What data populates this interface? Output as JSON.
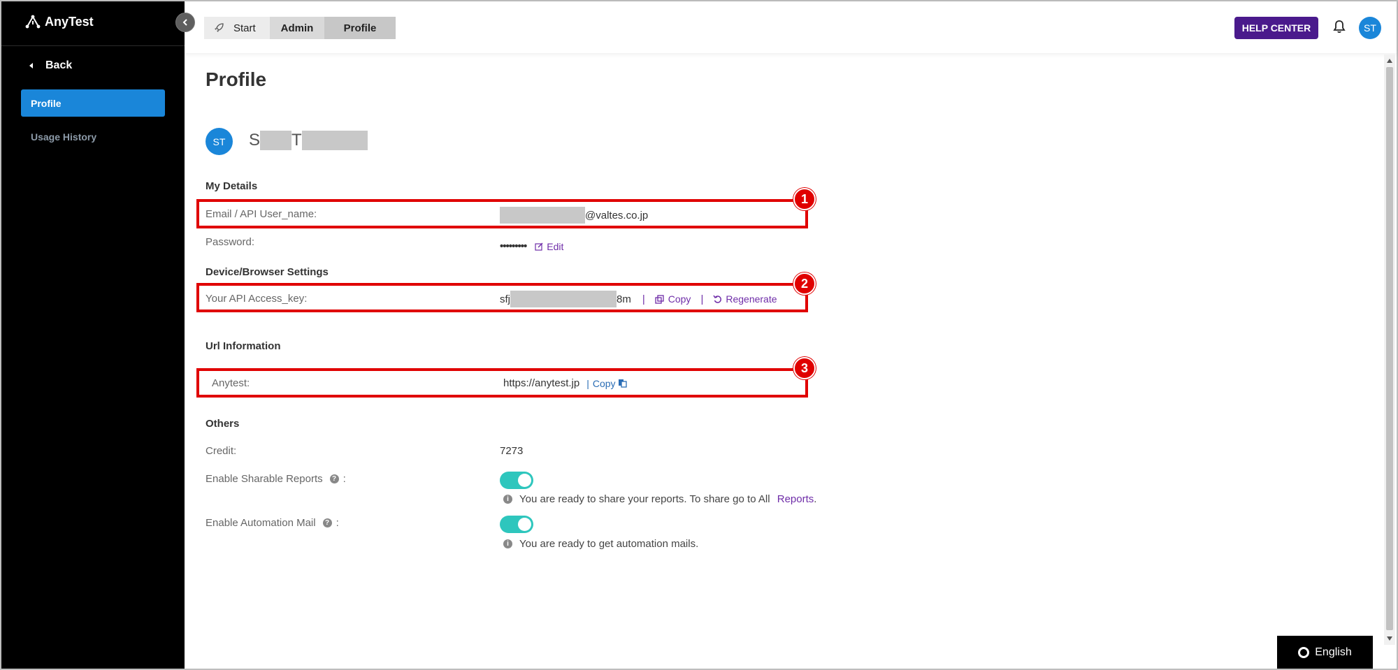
{
  "app": {
    "name": "AnyTest",
    "logo_icon": "anytest-logo-icon"
  },
  "sidebar": {
    "back_label": "Back",
    "items": [
      {
        "label": "Profile",
        "active": true
      },
      {
        "label": "Usage History",
        "active": false
      }
    ],
    "collapse_icon": "chevron-left-icon"
  },
  "topbar": {
    "breadcrumbs": [
      {
        "label": "Start",
        "icon": "rocket-icon"
      },
      {
        "label": "Admin"
      },
      {
        "label": "Profile"
      }
    ],
    "help_label": "HELP CENTER",
    "bell_icon": "bell-icon",
    "avatar_initials": "ST"
  },
  "profile": {
    "page_title": "Profile",
    "avatar_initials": "ST",
    "name_first_initial": "S",
    "name_last_initial": "T"
  },
  "my_details": {
    "heading": "My Details",
    "email_label": "Email / API User_name:",
    "email_domain": "@valtes.co.jp",
    "password_label": "Password:",
    "password_mask": "•••••••••",
    "edit_label": "Edit"
  },
  "device_settings": {
    "heading": "Device/Browser Settings",
    "access_key_label": "Your API Access_key:",
    "access_key_prefix": "sfj",
    "access_key_suffix": "8m",
    "separator": "|",
    "copy_label": "Copy",
    "regenerate_label": "Regenerate"
  },
  "url_info": {
    "heading": "Url Information",
    "anytest_label": "Anytest:",
    "anytest_url": "https://anytest.jp",
    "separator": "|",
    "copy_label": "Copy"
  },
  "others": {
    "heading": "Others",
    "credit_label": "Credit:",
    "credit_value": "7273",
    "sharable_label": "Enable Sharable Reports",
    "sharable_enabled": true,
    "sharable_info": "You are ready to share your reports. To share go to All",
    "sharable_link": "Reports",
    "sharable_period": ".",
    "automation_label": "Enable Automation Mail",
    "automation_enabled": true,
    "automation_info": "You are ready to get automation mails.",
    "colon": ":",
    "help_glyph": "?",
    "info_glyph": "i"
  },
  "annotations": [
    "1",
    "2",
    "3"
  ],
  "language": {
    "label": "English"
  },
  "colors": {
    "sidebar_bg": "#000000",
    "active_nav": "#1a86d9",
    "help_button": "#4a1a8c",
    "toggle_on": "#2ec6bd",
    "annotation_red": "#e00000",
    "link_purple": "#6f2da8"
  }
}
